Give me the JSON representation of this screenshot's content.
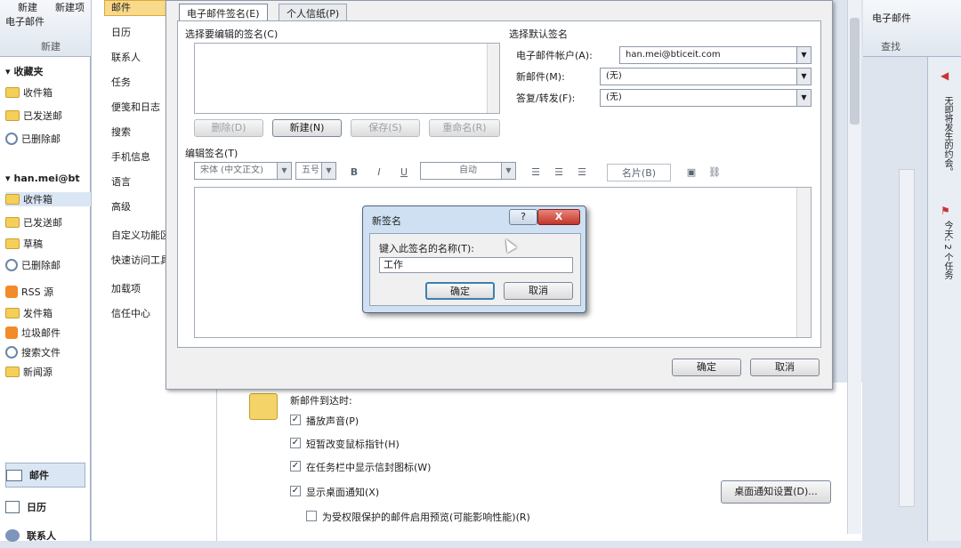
{
  "ribbon_left": {
    "new_label": "新建",
    "new_email": "电子邮件",
    "new_item": "新建项",
    "group_new": "新建"
  },
  "navpane": {
    "favorites_header": "收藏夹",
    "favorites": [
      "收件箱",
      "已发送邮",
      "已删除邮"
    ],
    "account_header": "han.mei@bt",
    "account_folders": [
      "收件箱",
      "已发送邮",
      "草稿",
      "已删除邮",
      "RSS 源",
      "发件箱",
      "垃圾邮件",
      "搜索文件",
      "新闻源"
    ],
    "bottom_mail": "邮件",
    "bottom_calendar": "日历",
    "bottom_contacts": "联系人"
  },
  "options_list": [
    "邮件",
    "日历",
    "联系人",
    "任务",
    "便笺和日志",
    "搜索",
    "手机信息",
    "语言",
    "高级",
    "自定义功能区",
    "快速访问工具栏",
    "加载项",
    "信任中心"
  ],
  "options_page": {
    "section_title": "新邮件到达时:",
    "items": [
      {
        "label": "播放声音(P)",
        "checked": true
      },
      {
        "label": "短暂改变鼠标指针(H)",
        "checked": true
      },
      {
        "label": "在任务栏中显示信封图标(W)",
        "checked": true
      },
      {
        "label": "显示桌面通知(X)",
        "checked": true
      },
      {
        "label": "为受权限保护的邮件启用预览(可能影响性能)(R)",
        "checked": false
      }
    ],
    "desktop_alert_button": "桌面通知设置(D)..."
  },
  "right": {
    "ribbon_text": "电子邮件",
    "group_label": "查找",
    "todo_label": "无即将发生的约会。",
    "todo_tasks": "今天: 2 个任务"
  },
  "sig_dialog": {
    "tab_email_sig": "电子邮件签名(E)",
    "tab_stationery": "个人信纸(P)",
    "select_to_edit": "选择要编辑的签名(C)",
    "btn_delete": "删除(D)",
    "btn_new": "新建(N)",
    "btn_save": "保存(S)",
    "btn_rename": "重命名(R)",
    "default_sig_header": "选择默认签名",
    "account_label": "电子邮件帐户(A):",
    "account_value": "han.mei@bticeit.com",
    "new_msg_label": "新邮件(M):",
    "new_msg_value": "(无)",
    "reply_label": "答复/转发(F):",
    "reply_value": "(无)",
    "edit_sig": "编辑签名(T)",
    "font_value": "宋体 (中文正文)",
    "size_value": "五号",
    "bold": "B",
    "italic": "I",
    "underline": "U",
    "color_value": "自动",
    "business_card": "名片(B)",
    "ok": "确定",
    "cancel": "取消"
  },
  "new_sig_dialog": {
    "title": "新签名",
    "prompt": "键入此签名的名称(T):",
    "input_value": "工作",
    "ok": "确定",
    "cancel": "取消",
    "help": "?",
    "close": "X"
  }
}
